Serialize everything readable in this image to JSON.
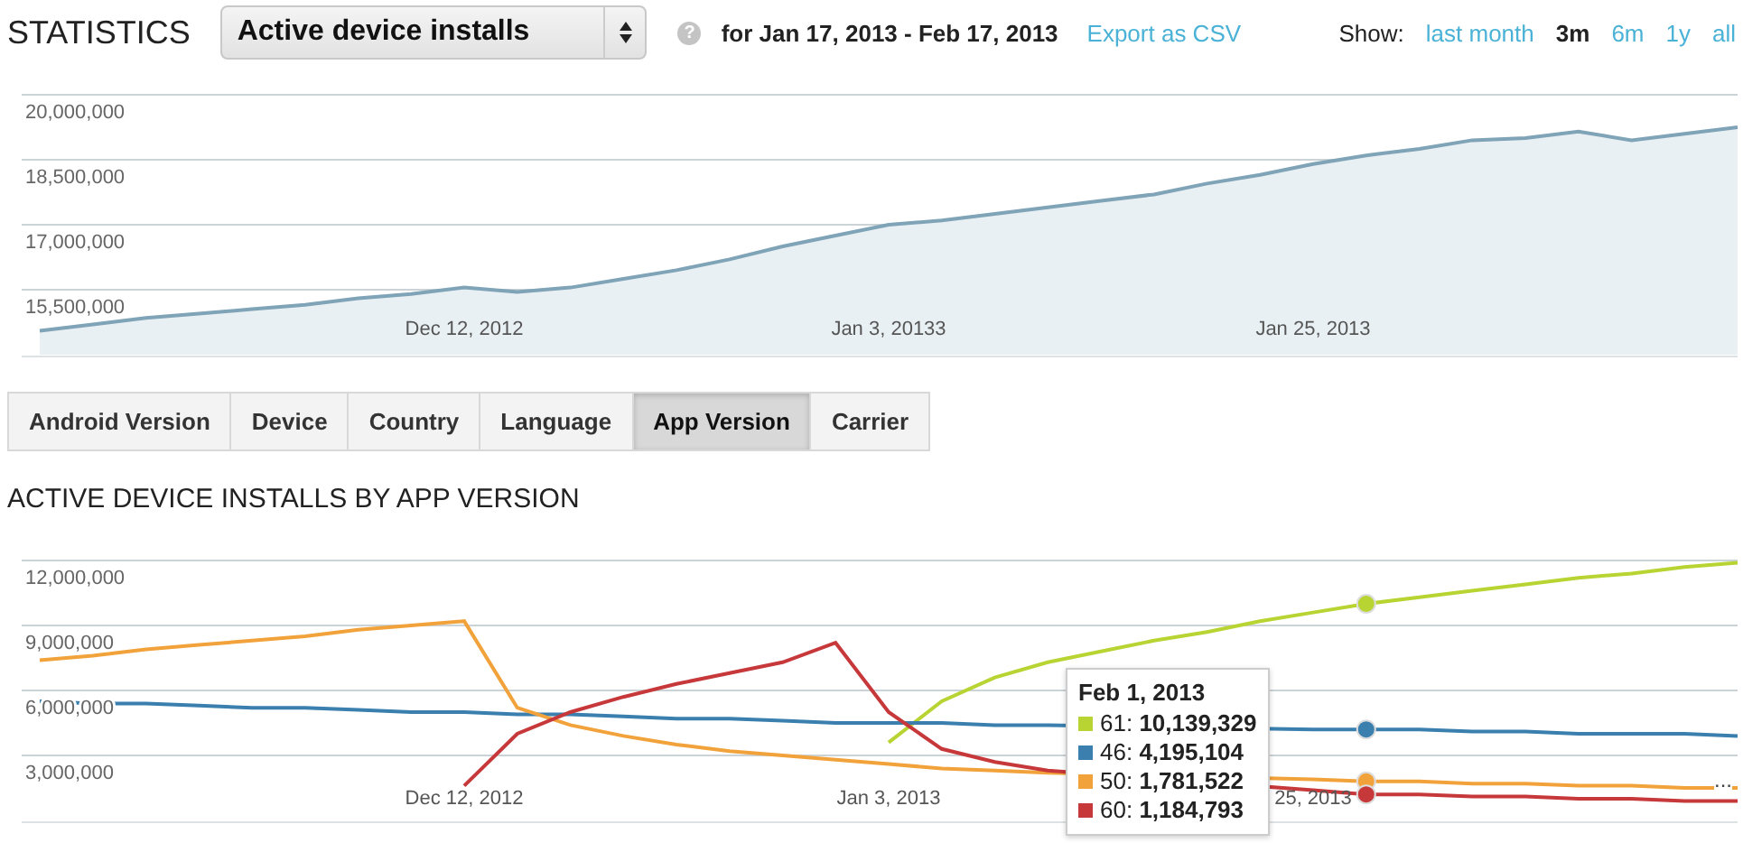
{
  "header": {
    "title": "STATISTICS",
    "metric_select": {
      "value": "Active device installs"
    },
    "help_icon": "?",
    "date_range": "for Jan 17, 2013 - Feb 17, 2013",
    "export_link": "Export as CSV",
    "show_label": "Show:",
    "ranges": [
      {
        "label": "last month",
        "selected": false
      },
      {
        "label": "3m",
        "selected": true
      },
      {
        "label": "6m",
        "selected": false
      },
      {
        "label": "1y",
        "selected": false
      },
      {
        "label": "all",
        "selected": false
      }
    ]
  },
  "overview_chart": {
    "chart_data": {
      "type": "area",
      "grid": true,
      "ylim": [
        14000000,
        22187500
      ],
      "yticks": [
        {
          "value": 15500000,
          "label": "15,500,000"
        },
        {
          "value": 17000000,
          "label": "17,000,000"
        },
        {
          "value": 18500000,
          "label": "18,500,000"
        },
        {
          "value": 20000000,
          "label": "20,000,000"
        }
      ],
      "categories": [
        null,
        null,
        null,
        null,
        null,
        null,
        null,
        null,
        "Dec 12, 2012",
        null,
        null,
        null,
        null,
        null,
        null,
        null,
        "Jan 3, 20133",
        null,
        null,
        null,
        null,
        null,
        null,
        null,
        "Jan 25, 2013",
        null,
        null,
        null,
        null,
        null,
        null,
        null,
        null
      ],
      "series": [
        {
          "color": "#7fa3b7",
          "values": [
            14550000,
            14700000,
            14850000,
            14950000,
            15050000,
            15150000,
            15300000,
            15400000,
            15550000,
            15450000,
            15550000,
            15750000,
            15950000,
            16200000,
            16500000,
            16750000,
            17000000,
            17100000,
            17250000,
            17400000,
            17550000,
            17700000,
            17950000,
            18150000,
            18400000,
            18600000,
            18750000,
            18950000,
            19000000,
            19150000,
            18950000,
            19100000,
            19250000
          ]
        }
      ]
    }
  },
  "tabs": [
    {
      "label": "Android Version",
      "selected": false
    },
    {
      "label": "Device",
      "selected": false
    },
    {
      "label": "Country",
      "selected": false
    },
    {
      "label": "Language",
      "selected": false
    },
    {
      "label": "App Version",
      "selected": true
    },
    {
      "label": "Carrier",
      "selected": false
    }
  ],
  "section_title": "ACTIVE DEVICE INSTALLS BY APP VERSION",
  "version_chart": {
    "chart_data": {
      "type": "line",
      "grid": true,
      "ylim": [
        0,
        12000000
      ],
      "yticks": [
        {
          "value": 3000000,
          "label": "3,000,000"
        },
        {
          "value": 6000000,
          "label": "6,000,000"
        },
        {
          "value": 9000000,
          "label": "9,000,000"
        },
        {
          "value": 12000000,
          "label": "12,000,000"
        }
      ],
      "categories": [
        null,
        null,
        null,
        null,
        null,
        null,
        null,
        null,
        "Dec 12, 2012",
        null,
        null,
        null,
        null,
        null,
        null,
        null,
        "Jan 3, 2013",
        null,
        null,
        null,
        null,
        null,
        null,
        null,
        "25, 2013",
        null,
        null,
        null,
        null,
        null,
        null,
        null,
        null
      ],
      "series": [
        {
          "color": "#b8d433",
          "values": [
            null,
            null,
            null,
            null,
            null,
            null,
            null,
            null,
            null,
            null,
            null,
            null,
            null,
            null,
            null,
            null,
            3600000,
            5500000,
            6600000,
            7300000,
            7800000,
            8300000,
            8700000,
            9200000,
            9600000,
            10000000,
            10300000,
            10600000,
            10900000,
            11200000,
            11400000,
            11700000,
            11900000
          ]
        },
        {
          "color": "#3a7fae",
          "values": [
            5500000,
            5400000,
            5400000,
            5300000,
            5200000,
            5200000,
            5100000,
            5000000,
            5000000,
            4900000,
            4900000,
            4800000,
            4700000,
            4700000,
            4600000,
            4500000,
            4500000,
            4500000,
            4400000,
            4400000,
            null,
            null,
            null,
            null,
            4200000,
            4200000,
            4200000,
            4100000,
            4100000,
            4000000,
            4000000,
            4000000,
            3900000
          ]
        },
        {
          "color": "#f2a23a",
          "values": [
            7400000,
            7600000,
            7900000,
            8100000,
            8300000,
            8500000,
            8800000,
            9000000,
            9200000,
            5200000,
            4400000,
            3900000,
            3500000,
            3200000,
            3000000,
            2800000,
            2600000,
            2400000,
            2300000,
            2200000,
            null,
            null,
            null,
            null,
            1900000,
            1800000,
            1800000,
            1700000,
            1700000,
            1600000,
            1600000,
            1500000,
            1500000
          ]
        },
        {
          "color": "#c7383a",
          "values": [
            null,
            null,
            null,
            null,
            null,
            null,
            null,
            null,
            1600000,
            4000000,
            5000000,
            5700000,
            6300000,
            6800000,
            7300000,
            8200000,
            5000000,
            3300000,
            2700000,
            2300000,
            null,
            null,
            null,
            null,
            1400000,
            1200000,
            1200000,
            1100000,
            1100000,
            1000000,
            1000000,
            900000,
            900000
          ]
        }
      ]
    },
    "more_marker": "...",
    "tooltip": {
      "date": "Feb 1, 2013",
      "entries": [
        {
          "text": "61: **10,139,329**",
          "color": "#b8d433"
        },
        {
          "text": "46: **4,195,104**",
          "color": "#3a7fae"
        },
        {
          "text": "50: **1,781,522**",
          "color": "#f2a23a"
        },
        {
          "text": "60: **1,184,793**",
          "color": "#c7383a"
        }
      ]
    }
  }
}
